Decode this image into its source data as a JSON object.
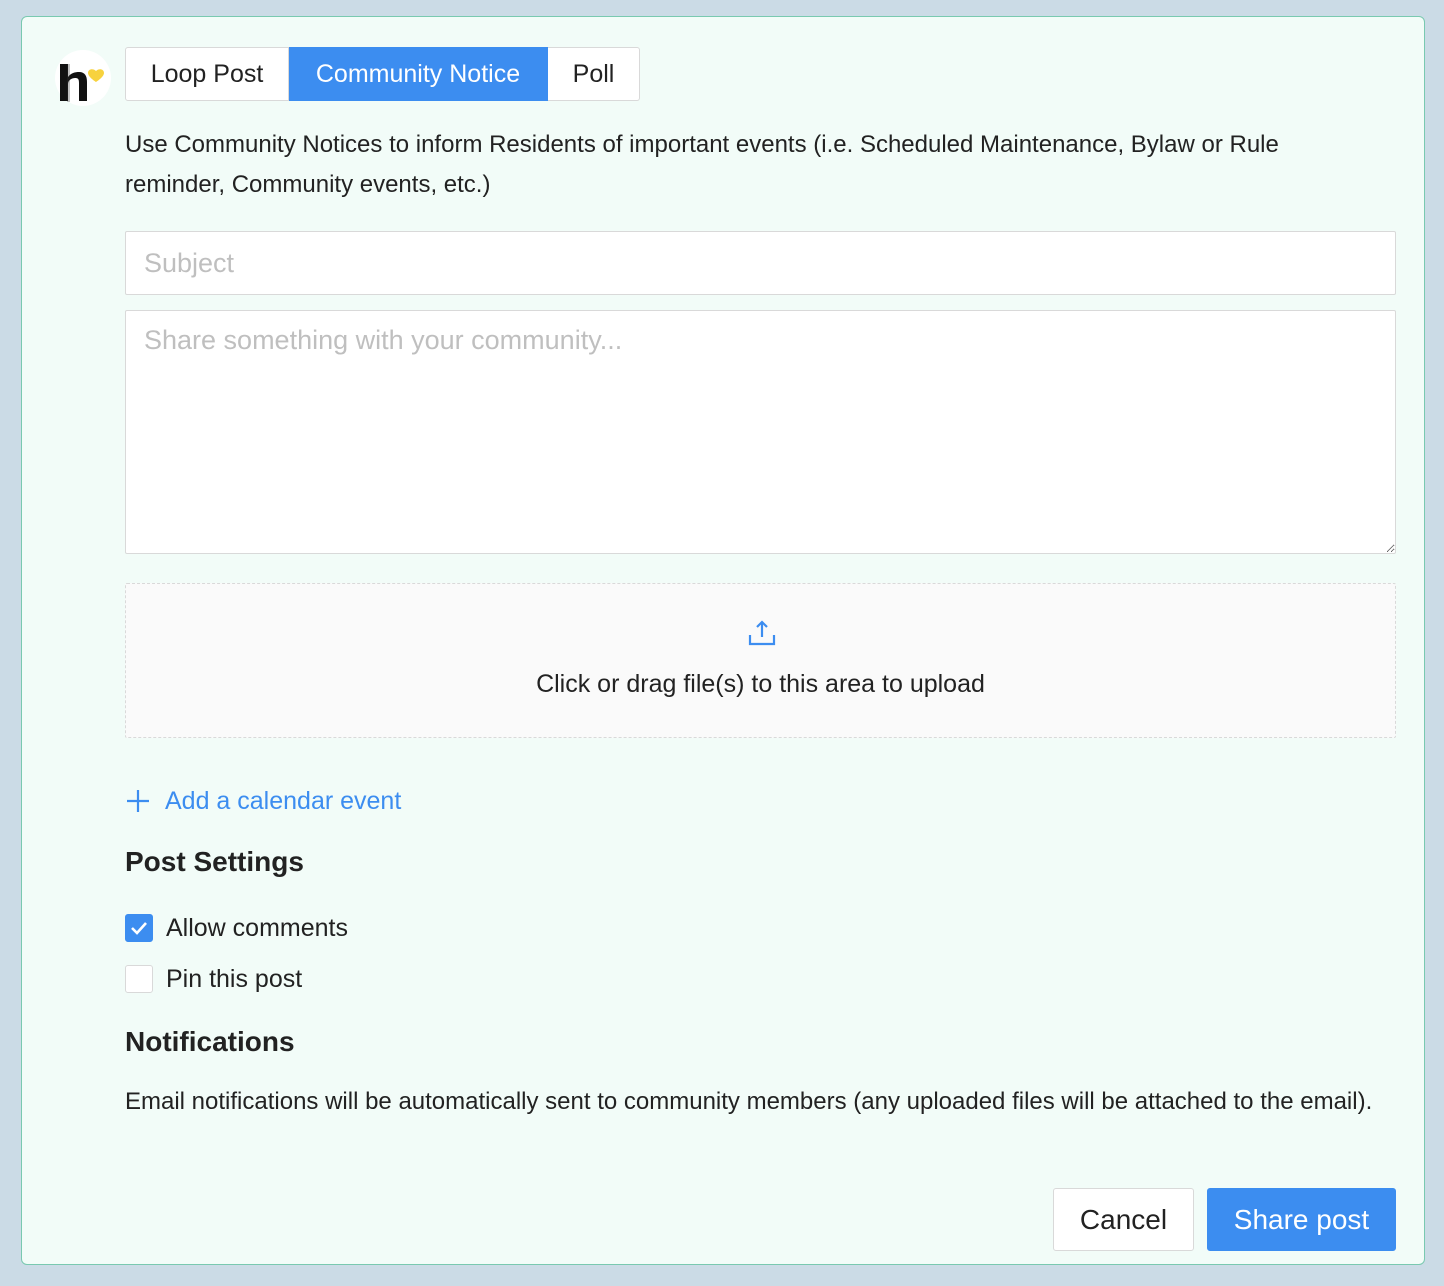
{
  "tabs": [
    {
      "label": "Loop Post",
      "active": false
    },
    {
      "label": "Community Notice",
      "active": true
    },
    {
      "label": "Poll",
      "active": false
    }
  ],
  "description": "Use Community Notices to inform Residents of important events (i.e. Scheduled Maintenance, Bylaw or Rule reminder, Community events, etc.)",
  "form": {
    "subject_value": "",
    "subject_placeholder": "Subject",
    "body_value": "",
    "body_placeholder": "Share something with your community..."
  },
  "upload": {
    "icon": "upload-icon",
    "text": "Click or drag file(s) to this area to upload"
  },
  "add_event": {
    "icon": "plus-icon",
    "label": "Add a calendar event"
  },
  "post_settings": {
    "title": "Post Settings",
    "options": [
      {
        "label": "Allow comments",
        "checked": true
      },
      {
        "label": "Pin this post",
        "checked": false
      }
    ]
  },
  "notifications": {
    "title": "Notifications",
    "text": "Email notifications will be automatically sent to community members (any uploaded files will be attached to the email)."
  },
  "actions": {
    "cancel_label": "Cancel",
    "share_label": "Share post"
  },
  "colors": {
    "accent": "#3c8df0",
    "card_background": "#f2fcf8",
    "card_border": "#79c9b0",
    "page_background": "#cbdbe6",
    "logo_heart": "#f7d23e"
  }
}
